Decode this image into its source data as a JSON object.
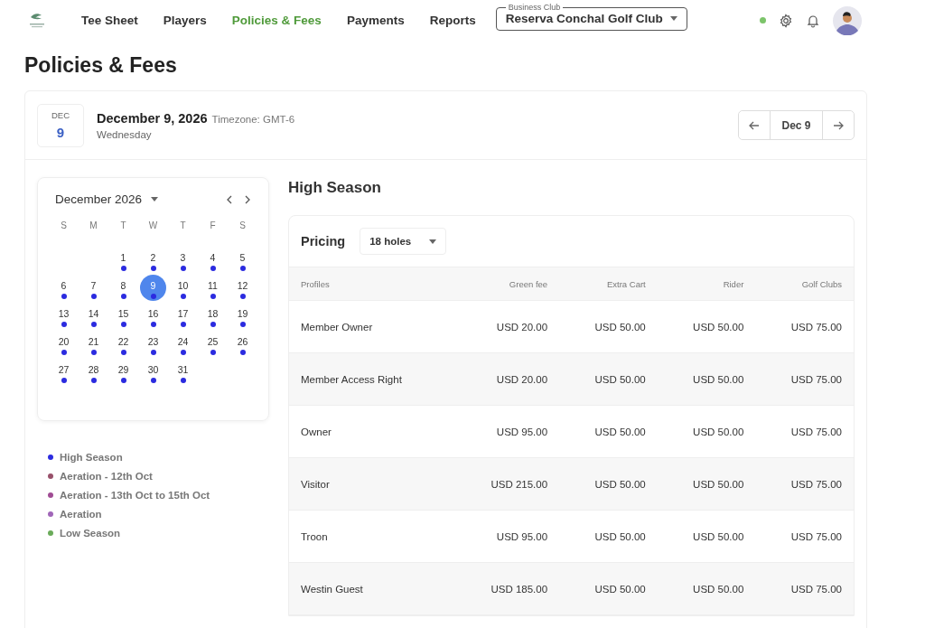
{
  "nav": {
    "items": [
      {
        "label": "Tee Sheet",
        "selected": false
      },
      {
        "label": "Players",
        "selected": false
      },
      {
        "label": "Policies & Fees",
        "selected": true
      },
      {
        "label": "Payments",
        "selected": false
      },
      {
        "label": "Reports",
        "selected": false
      }
    ],
    "club_select": {
      "label": "Business Club",
      "value": "Reserva Conchal Golf Club"
    },
    "online": true
  },
  "page_title": "Policies & Fees",
  "date_header": {
    "month": "DEC",
    "day": "9",
    "date": "December 9, 2026",
    "timezone": "Timezone: GMT-6",
    "weekday": "Wednesday",
    "pager": "Dec 9"
  },
  "calendar": {
    "month": "December 2026",
    "weekdays": [
      "S",
      "M",
      "T",
      "W",
      "T",
      "F",
      "S"
    ],
    "weeks": [
      [
        {
          "kind": "blank"
        },
        {
          "kind": "blank"
        },
        {
          "kind": "day",
          "label": "1",
          "selected": false,
          "color": "#2b2be0"
        },
        {
          "kind": "day",
          "label": "2",
          "selected": false,
          "color": "#2b2be0"
        },
        {
          "kind": "day",
          "label": "3",
          "selected": false,
          "color": "#2b2be0"
        },
        {
          "kind": "day",
          "label": "4",
          "selected": false,
          "color": "#2b2be0"
        },
        {
          "kind": "day",
          "label": "5",
          "selected": false,
          "color": "#2b2be0"
        }
      ],
      [
        {
          "kind": "day",
          "label": "6",
          "selected": false,
          "color": "#2b2be0"
        },
        {
          "kind": "day",
          "label": "7",
          "selected": false,
          "color": "#2b2be0"
        },
        {
          "kind": "day",
          "label": "8",
          "selected": false,
          "color": "#2b2be0"
        },
        {
          "kind": "day",
          "label": "9",
          "selected": true,
          "color": "#2b2be0"
        },
        {
          "kind": "day",
          "label": "10",
          "selected": false,
          "color": "#2b2be0"
        },
        {
          "kind": "day",
          "label": "11",
          "selected": false,
          "color": "#2b2be0"
        },
        {
          "kind": "day",
          "label": "12",
          "selected": false,
          "color": "#2b2be0"
        }
      ],
      [
        {
          "kind": "day",
          "label": "13",
          "selected": false,
          "color": "#2b2be0"
        },
        {
          "kind": "day",
          "label": "14",
          "selected": false,
          "color": "#2b2be0"
        },
        {
          "kind": "day",
          "label": "15",
          "selected": false,
          "color": "#2b2be0"
        },
        {
          "kind": "day",
          "label": "16",
          "selected": false,
          "color": "#2b2be0"
        },
        {
          "kind": "day",
          "label": "17",
          "selected": false,
          "color": "#2b2be0"
        },
        {
          "kind": "day",
          "label": "18",
          "selected": false,
          "color": "#2b2be0"
        },
        {
          "kind": "day",
          "label": "19",
          "selected": false,
          "color": "#2b2be0"
        }
      ],
      [
        {
          "kind": "day",
          "label": "20",
          "selected": false,
          "color": "#2b2be0"
        },
        {
          "kind": "day",
          "label": "21",
          "selected": false,
          "color": "#2b2be0"
        },
        {
          "kind": "day",
          "label": "22",
          "selected": false,
          "color": "#2b2be0"
        },
        {
          "kind": "day",
          "label": "23",
          "selected": false,
          "color": "#2b2be0"
        },
        {
          "kind": "day",
          "label": "24",
          "selected": false,
          "color": "#2b2be0"
        },
        {
          "kind": "day",
          "label": "25",
          "selected": false,
          "color": "#2b2be0"
        },
        {
          "kind": "day",
          "label": "26",
          "selected": false,
          "color": "#2b2be0"
        }
      ],
      [
        {
          "kind": "day",
          "label": "27",
          "selected": false,
          "color": "#2b2be0"
        },
        {
          "kind": "day",
          "label": "28",
          "selected": false,
          "color": "#2b2be0"
        },
        {
          "kind": "day",
          "label": "29",
          "selected": false,
          "color": "#2b2be0"
        },
        {
          "kind": "day",
          "label": "30",
          "selected": false,
          "color": "#2b2be0"
        },
        {
          "kind": "day",
          "label": "31",
          "selected": false,
          "color": "#2b2be0"
        }
      ]
    ]
  },
  "legend": [
    {
      "label": "High Season",
      "color": "#2b2be0"
    },
    {
      "label": "Aeration - 12th Oct",
      "color": "#98506a"
    },
    {
      "label": "Aeration - 13th Oct to 15th Oct",
      "color": "#a04c94"
    },
    {
      "label": "Aeration",
      "color": "#a066b8"
    },
    {
      "label": "Low Season",
      "color": "#6aab5a"
    }
  ],
  "season_title": "High Season",
  "pricing": {
    "title": "Pricing",
    "holes": "18 holes",
    "columns": [
      "Profiles",
      "Green fee",
      "Extra Cart",
      "Rider",
      "Golf Clubs"
    ],
    "rows": [
      [
        "Member Owner",
        "USD 20.00",
        "USD 50.00",
        "USD 50.00",
        "USD 75.00"
      ],
      [
        "Member Access Right",
        "USD 20.00",
        "USD 50.00",
        "USD 50.00",
        "USD 75.00"
      ],
      [
        "Owner",
        "USD 95.00",
        "USD 50.00",
        "USD 50.00",
        "USD 75.00"
      ],
      [
        "Visitor",
        "USD 215.00",
        "USD 50.00",
        "USD 50.00",
        "USD 75.00"
      ],
      [
        "Troon",
        "USD 95.00",
        "USD 50.00",
        "USD 50.00",
        "USD 75.00"
      ],
      [
        "Westin Guest",
        "USD 185.00",
        "USD 50.00",
        "USD 50.00",
        "USD 75.00"
      ]
    ]
  }
}
